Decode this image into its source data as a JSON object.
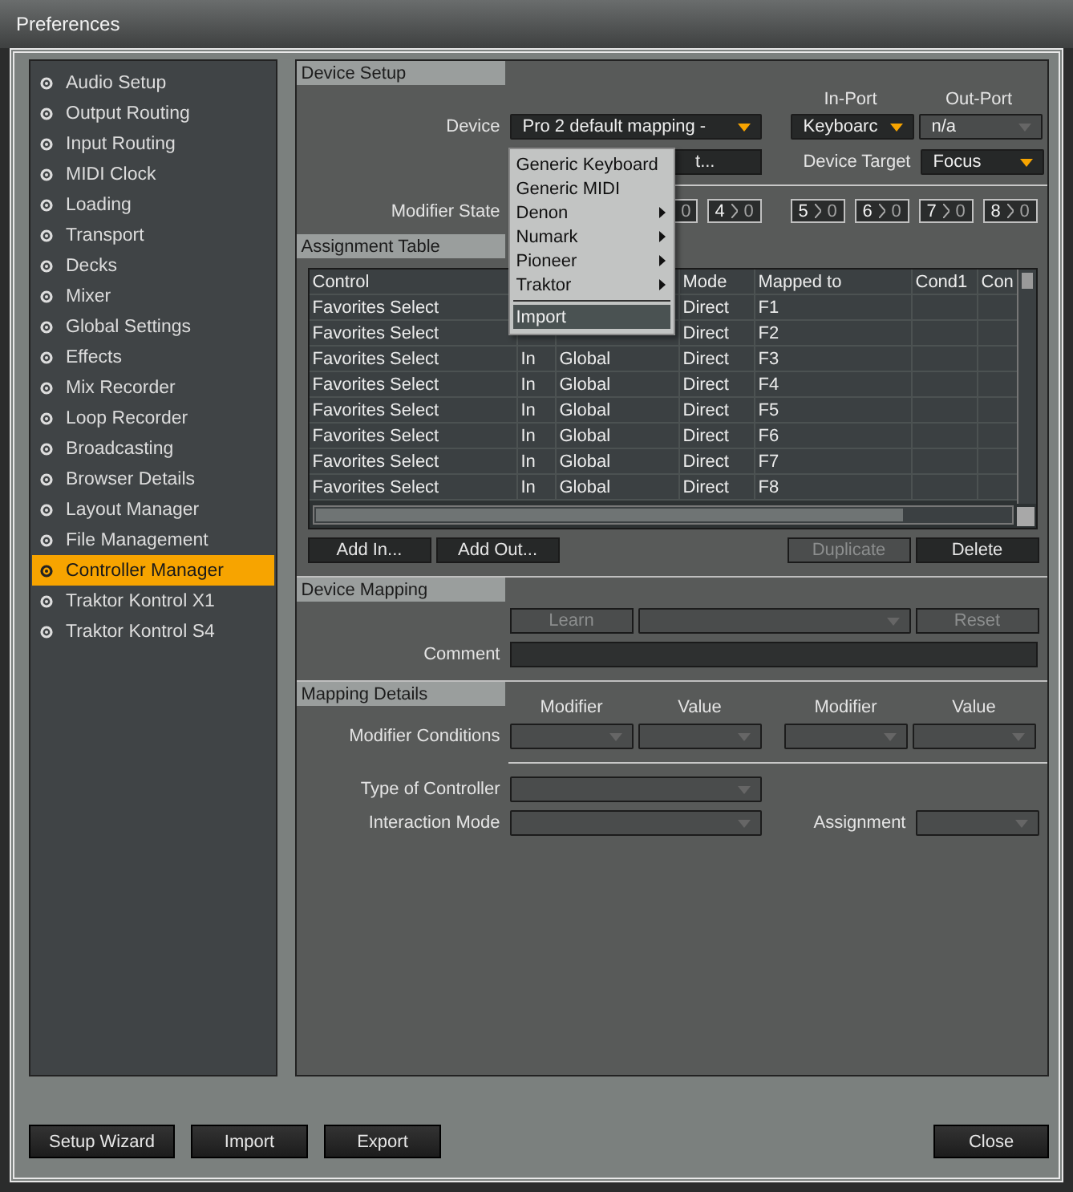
{
  "window": {
    "title": "Preferences"
  },
  "sidebar": {
    "items": [
      {
        "label": "Audio Setup",
        "selected": false
      },
      {
        "label": "Output Routing",
        "selected": false
      },
      {
        "label": "Input Routing",
        "selected": false
      },
      {
        "label": "MIDI Clock",
        "selected": false
      },
      {
        "label": "Loading",
        "selected": false
      },
      {
        "label": "Transport",
        "selected": false
      },
      {
        "label": "Decks",
        "selected": false
      },
      {
        "label": "Mixer",
        "selected": false
      },
      {
        "label": "Global Settings",
        "selected": false
      },
      {
        "label": "Effects",
        "selected": false
      },
      {
        "label": "Mix Recorder",
        "selected": false
      },
      {
        "label": "Loop Recorder",
        "selected": false
      },
      {
        "label": "Broadcasting",
        "selected": false
      },
      {
        "label": "Browser Details",
        "selected": false
      },
      {
        "label": "Layout Manager",
        "selected": false
      },
      {
        "label": "File Management",
        "selected": false
      },
      {
        "label": "Controller Manager",
        "selected": true
      },
      {
        "label": "Traktor Kontrol X1",
        "selected": false
      },
      {
        "label": "Traktor Kontrol S4",
        "selected": false
      }
    ]
  },
  "device_setup": {
    "title": "Device Setup",
    "in_port_label": "In-Port",
    "out_port_label": "Out-Port",
    "device_label": "Device",
    "device_value": "Pro 2 default mapping -",
    "in_port": {
      "value": "Keyboarc",
      "disabled": false
    },
    "out_port": {
      "value": "n/a",
      "disabled": true
    },
    "import_export_button": "t...",
    "device_target_label": "Device Target",
    "device_target": "Focus",
    "modifier_state_label": "Modifier State",
    "modifiers": [
      [
        {
          "value": "0"
        },
        {
          "index": "4",
          "value": "0"
        }
      ],
      [
        {
          "index": "5",
          "value": "0"
        },
        {
          "index": "6",
          "value": "0"
        },
        {
          "index": "7",
          "value": "0"
        },
        {
          "index": "8",
          "value": "0"
        }
      ]
    ]
  },
  "device_menu": {
    "items": [
      {
        "kind": "item",
        "label": "Generic Keyboard",
        "submenu": false,
        "selected": false
      },
      {
        "kind": "item",
        "label": "Generic MIDI",
        "submenu": false,
        "selected": false
      },
      {
        "kind": "item",
        "label": "Denon",
        "submenu": true,
        "selected": false
      },
      {
        "kind": "item",
        "label": "Numark",
        "submenu": true,
        "selected": false
      },
      {
        "kind": "item",
        "label": "Pioneer",
        "submenu": true,
        "selected": false
      },
      {
        "kind": "item",
        "label": "Traktor",
        "submenu": true,
        "selected": false
      },
      {
        "kind": "separator"
      },
      {
        "kind": "item",
        "label": "Import",
        "submenu": false,
        "selected": true
      }
    ]
  },
  "assignment_table": {
    "title": "Assignment Table",
    "columns": [
      "Control",
      "",
      "",
      "Mode",
      "Mapped to",
      "Cond1",
      "Con"
    ],
    "rows": [
      [
        "Favorites Select",
        "",
        "",
        "Direct",
        "F1"
      ],
      [
        "Favorites Select",
        "",
        "",
        "Direct",
        "F2"
      ],
      [
        "Favorites Select",
        "In",
        "Global",
        "Direct",
        "F3"
      ],
      [
        "Favorites Select",
        "In",
        "Global",
        "Direct",
        "F4"
      ],
      [
        "Favorites Select",
        "In",
        "Global",
        "Direct",
        "F5"
      ],
      [
        "Favorites Select",
        "In",
        "Global",
        "Direct",
        "F6"
      ],
      [
        "Favorites Select",
        "In",
        "Global",
        "Direct",
        "F7"
      ],
      [
        "Favorites Select",
        "In",
        "Global",
        "Direct",
        "F8"
      ]
    ],
    "buttons": [
      {
        "label": "Add In...",
        "disabled": false
      },
      {
        "label": "Add Out...",
        "disabled": false
      },
      {
        "label": "Duplicate",
        "disabled": true
      },
      {
        "label": "Delete",
        "disabled": false
      }
    ]
  },
  "device_mapping": {
    "title": "Device Mapping",
    "learn": {
      "label": "Learn",
      "disabled": true
    },
    "reset": {
      "label": "Reset",
      "disabled": true
    },
    "comment_label": "Comment"
  },
  "mapping_details": {
    "title": "Mapping Details",
    "headers": [
      "Modifier",
      "Value",
      "Modifier",
      "Value"
    ],
    "modifier_conditions_label": "Modifier Conditions",
    "type_label": "Type of Controller",
    "interaction_label": "Interaction Mode",
    "assignment_label": "Assignment"
  },
  "footer": {
    "buttons": [
      "Setup Wizard",
      "Import",
      "Export"
    ],
    "close": "Close"
  }
}
